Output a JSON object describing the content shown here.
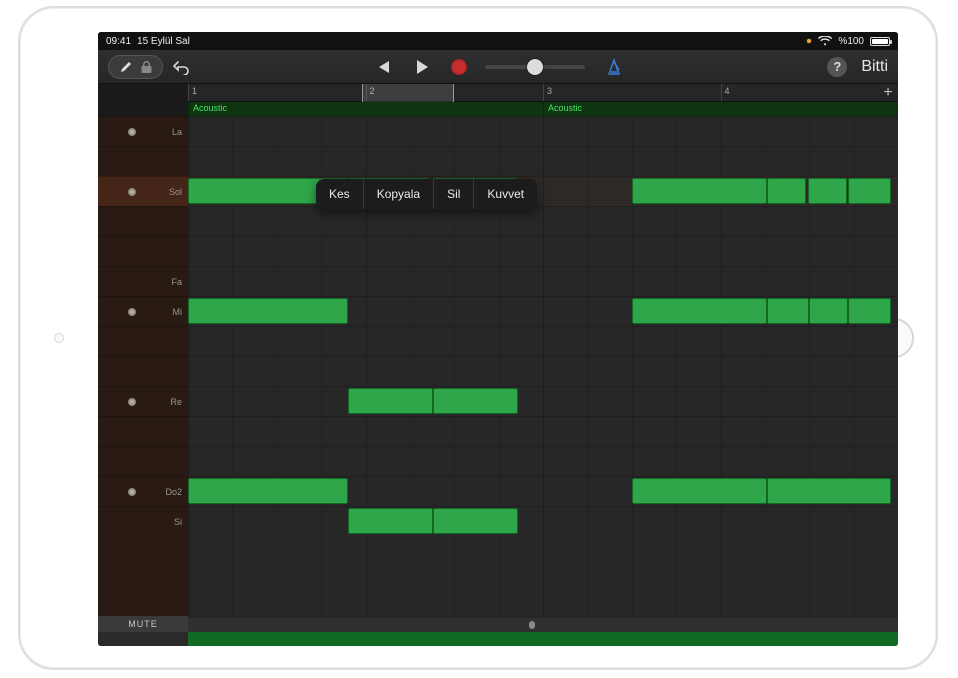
{
  "status": {
    "time": "09:41",
    "date": "15 Eylül Sal",
    "battery_text": "%100"
  },
  "toolbar": {
    "done_label": "Bitti"
  },
  "ruler": {
    "bars": [
      "1",
      "2",
      "3",
      "4"
    ]
  },
  "regions": {
    "a": "Acoustic",
    "b": "Acoustic"
  },
  "tracks": {
    "rows": [
      {
        "label": "La",
        "dot": true
      },
      {
        "label": "",
        "dot": false
      },
      {
        "label": "Sol",
        "dot": true,
        "highlight": true
      },
      {
        "label": "",
        "dot": false
      },
      {
        "label": "",
        "dot": false
      },
      {
        "label": "Fa",
        "dot": false
      },
      {
        "label": "Mi",
        "dot": true
      },
      {
        "label": "",
        "dot": false
      },
      {
        "label": "",
        "dot": false
      },
      {
        "label": "Re",
        "dot": true
      },
      {
        "label": "",
        "dot": false
      },
      {
        "label": "",
        "dot": false
      },
      {
        "label": "Do2",
        "dot": true
      },
      {
        "label": "Si",
        "dot": false
      }
    ],
    "mute_label": "MUTE"
  },
  "context_menu": {
    "items": [
      "Kes",
      "Kopyala",
      "Sil",
      "Kuvvet"
    ]
  },
  "notes": [
    {
      "row": 2,
      "start": 0.0,
      "len": 0.225
    },
    {
      "row": 2,
      "start": 0.225,
      "len": 0.115,
      "selected": true
    },
    {
      "row": 2,
      "start": 0.345,
      "len": 0.12
    },
    {
      "row": 2,
      "start": 0.625,
      "len": 0.19
    },
    {
      "row": 2,
      "start": 0.815,
      "len": 0.055
    },
    {
      "row": 2,
      "start": 0.873,
      "len": 0.055
    },
    {
      "row": 2,
      "start": 0.93,
      "len": 0.06
    },
    {
      "row": 6,
      "start": 0.0,
      "len": 0.225
    },
    {
      "row": 6,
      "start": 0.625,
      "len": 0.19
    },
    {
      "row": 6,
      "start": 0.815,
      "len": 0.06
    },
    {
      "row": 6,
      "start": 0.875,
      "len": 0.055
    },
    {
      "row": 6,
      "start": 0.93,
      "len": 0.06
    },
    {
      "row": 9,
      "start": 0.225,
      "len": 0.12
    },
    {
      "row": 9,
      "start": 0.345,
      "len": 0.12
    },
    {
      "row": 12,
      "start": 0.0,
      "len": 0.225
    },
    {
      "row": 12,
      "start": 0.625,
      "len": 0.19
    },
    {
      "row": 12,
      "start": 0.815,
      "len": 0.175
    },
    {
      "row": 13,
      "start": 0.225,
      "len": 0.12
    },
    {
      "row": 13,
      "start": 0.345,
      "len": 0.12
    }
  ]
}
